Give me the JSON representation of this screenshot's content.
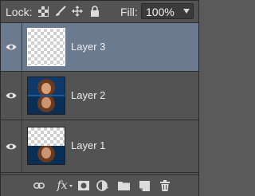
{
  "toolbar": {
    "lock_label": "Lock:",
    "fill_label": "Fill:",
    "fill_value": "100%",
    "lock_icons": [
      "lock-transparent-pixels-icon",
      "lock-image-pixels-icon",
      "lock-position-icon",
      "lock-all-icon"
    ]
  },
  "layers": [
    {
      "name": "Layer 3",
      "selected": true,
      "visible": true,
      "thumbnail": "transparent"
    },
    {
      "name": "Layer 2",
      "selected": false,
      "visible": true,
      "thumbnail": "photo"
    },
    {
      "name": "Layer 1",
      "selected": false,
      "visible": true,
      "thumbnail": "photo-partial"
    }
  ],
  "bottom": {
    "fx_label": "fx",
    "icons": [
      "link-layers-icon",
      "layer-style-fx-icon",
      "add-mask-icon",
      "adjustment-layer-icon",
      "new-group-icon",
      "new-layer-icon",
      "delete-layer-icon"
    ]
  },
  "colors": {
    "panel_bg": "#535353",
    "selected_row": "#6c7a90"
  }
}
